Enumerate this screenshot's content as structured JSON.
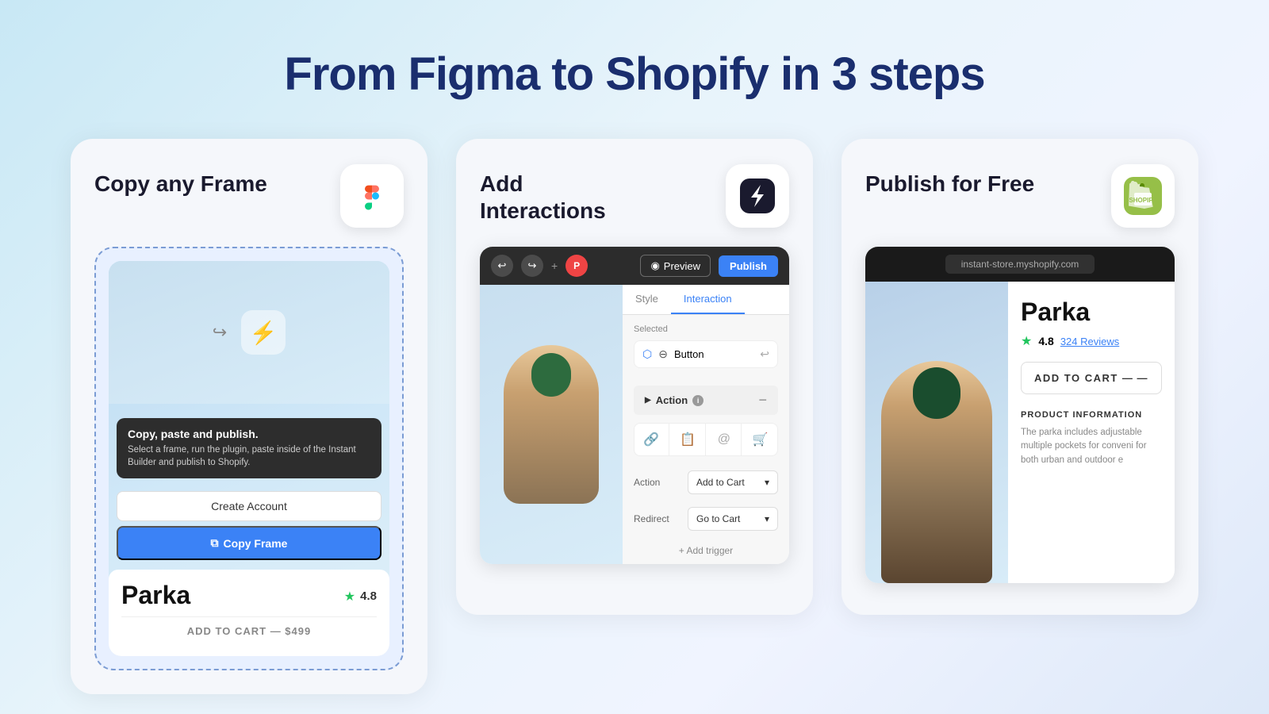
{
  "page": {
    "title": "From Figma to Shopify in 3 steps"
  },
  "card1": {
    "title": "Copy any Frame",
    "app_icon_alt": "Figma icon",
    "tooltip_title": "Copy, paste and publish.",
    "tooltip_desc": "Select a frame, run the plugin, paste inside of the Instant Builder and publish to Shopify.",
    "btn_create": "Create Account",
    "btn_copy": "Copy Frame",
    "product_name": "Parka",
    "rating": "4.8",
    "add_to_cart": "ADD TO CART — $499"
  },
  "card2": {
    "title": "Add Interactions",
    "app_icon_alt": "Instant Builder icon",
    "toolbar": {
      "preview": "Preview",
      "publish": "Publish"
    },
    "tabs": {
      "style": "Style",
      "interaction": "Interaction"
    },
    "selected_label": "Selected",
    "component_name": "Button",
    "action_section": "Action",
    "action_label": "Action",
    "action_value": "Add to Cart",
    "redirect_label": "Redirect",
    "redirect_value": "Go to Cart",
    "add_trigger": "+ Add trigger"
  },
  "card3": {
    "title": "Publish for Free",
    "app_icon_alt": "Shopify icon",
    "url": "instant-store.myshopify.com",
    "product_name": "Parka",
    "rating": "4.8",
    "reviews": "324 Reviews",
    "add_to_cart": "ADD TO CART —",
    "section_title": "PRODUCT INFORMATION",
    "section_desc": "The parka includes adjustable multiple pockets for conveni for both urban and outdoor e"
  }
}
